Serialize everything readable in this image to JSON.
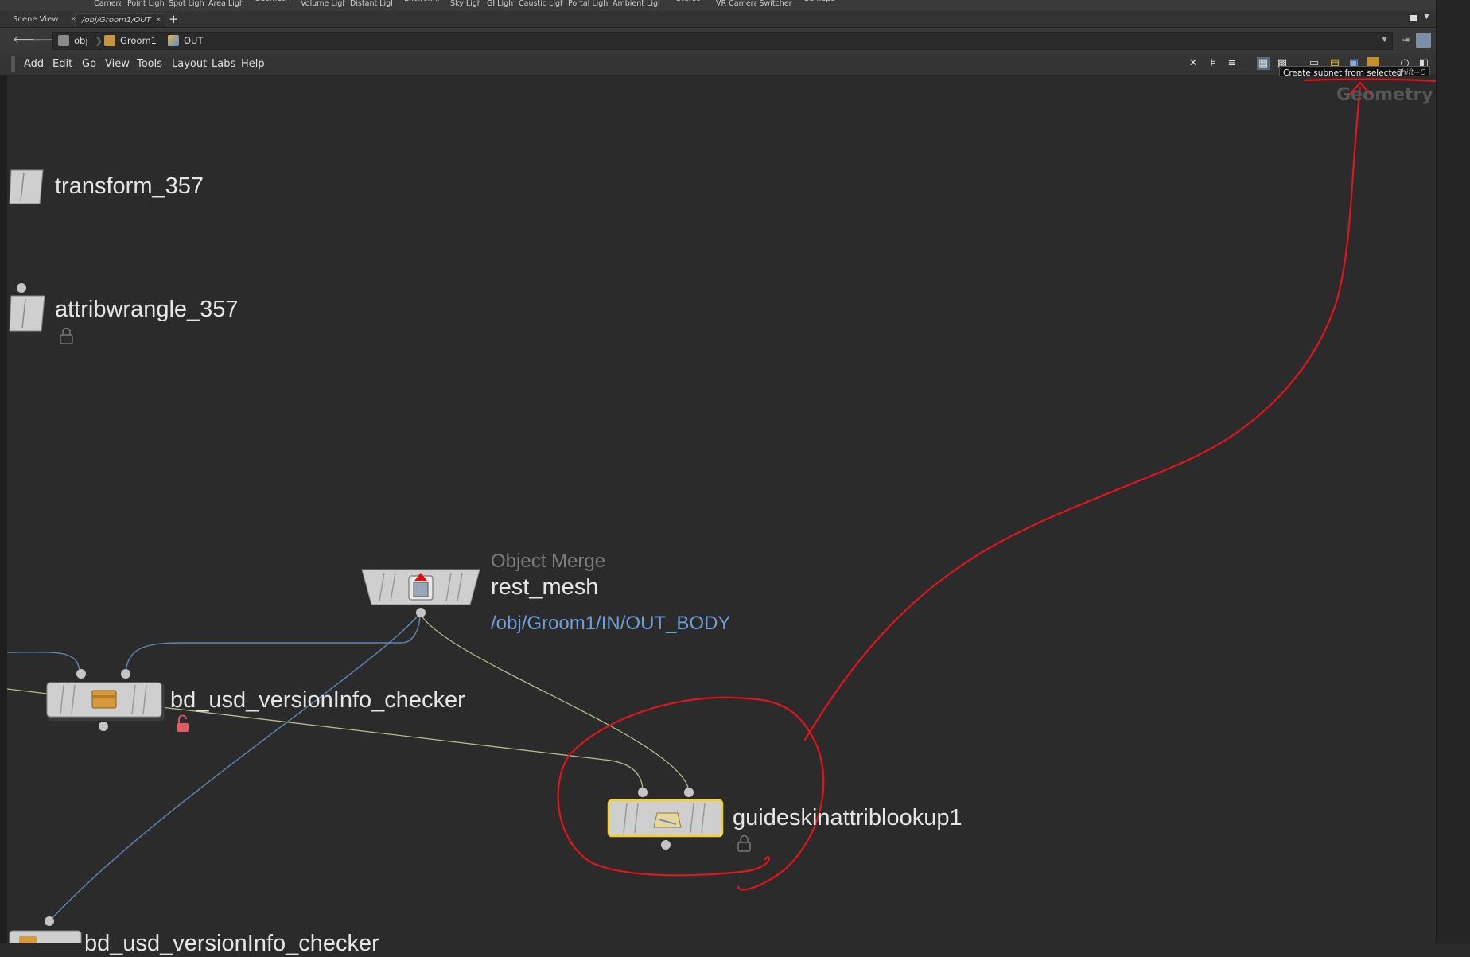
{
  "shelf": {
    "tools": [
      "Camera",
      "Point Light",
      "Spot Light",
      "Area Light",
      "Geometry Light",
      "Volume Light",
      "Distant Light",
      "Environment Light",
      "Sky Light",
      "GI Light",
      "Caustic Light",
      "Portal Light",
      "Ambient Light",
      "Stereo Camera",
      "VR Camera",
      "Switcher",
      "Gamepad Camera"
    ]
  },
  "tabs": [
    {
      "label": "Scene View",
      "active": false
    },
    {
      "label": "/obj/Groom1/OUT",
      "active": true
    }
  ],
  "tab_add_label": "+",
  "path": {
    "crumbs": [
      {
        "label": "obj",
        "icon": "obj-network-icon"
      },
      {
        "label": "Groom1",
        "icon": "groom-object-icon"
      },
      {
        "label": "OUT",
        "icon": "sop-network-icon"
      }
    ]
  },
  "menu": [
    "Add",
    "Edit",
    "Go",
    "View",
    "Tools",
    "Layout",
    "Labs",
    "Help"
  ],
  "tooltip": {
    "text": "Create subnet from selected",
    "shortcut": "Shift+C"
  },
  "context_label": "Geometry",
  "nodes": {
    "transform": {
      "name": "transform_357"
    },
    "wrangle": {
      "name": "attribwrangle_357"
    },
    "object_merge": {
      "type": "Object Merge",
      "name": "rest_mesh",
      "path": "/obj/Groom1/IN/OUT_BODY"
    },
    "checker": {
      "name": "bd_usd_versionInfo_checker"
    },
    "lookup": {
      "name": "guideskinattriblookup1"
    },
    "bottom": {
      "name": "bd_usd_versionInfo_checker"
    }
  },
  "colors": {
    "background": "#2b2b2b",
    "annotation": "#e0161b",
    "wire_blue": "#5e86b5",
    "wire_yellow": "#b8b98a",
    "selected_outline": "#f5d31d",
    "node_body": "#cfcfcf",
    "path_blue": "#6f9fd4"
  }
}
